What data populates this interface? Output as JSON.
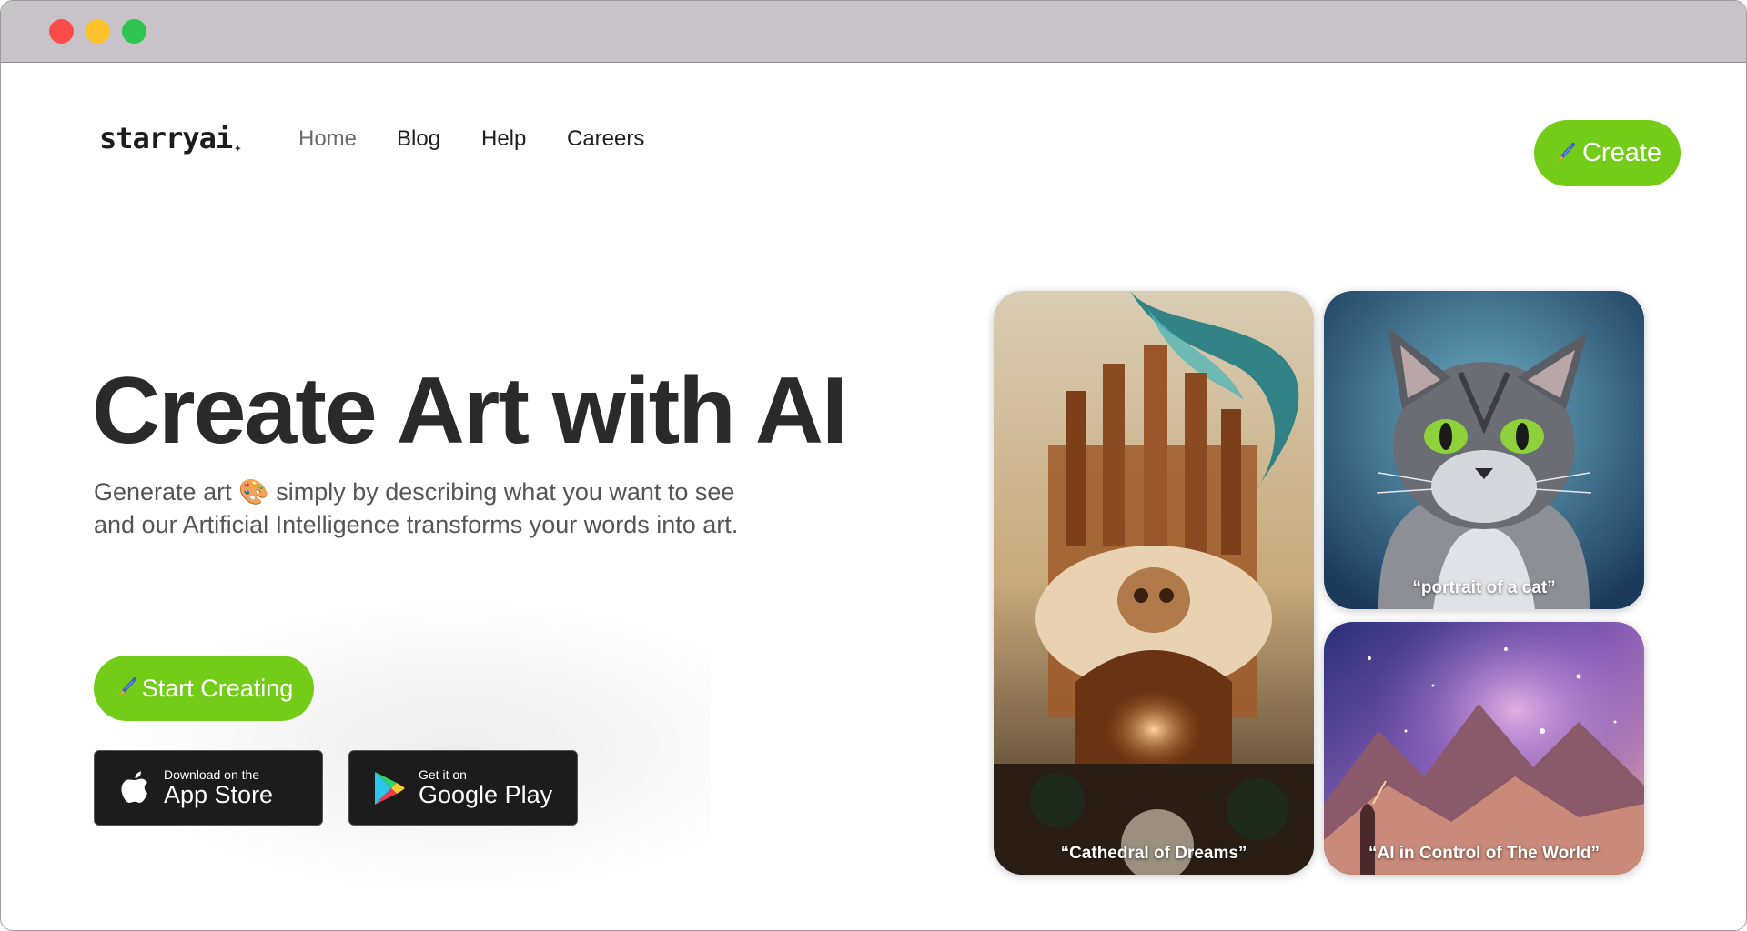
{
  "brand": {
    "logo_text": "starryai",
    "logo_mark": "✦"
  },
  "nav": {
    "items": [
      {
        "label": "Home",
        "active": true
      },
      {
        "label": "Blog",
        "active": false
      },
      {
        "label": "Help",
        "active": false
      },
      {
        "label": "Careers",
        "active": false
      }
    ]
  },
  "header": {
    "create_button": {
      "icon": "paintbrush-icon",
      "label": "Create"
    }
  },
  "hero": {
    "title": "Create Art with AI",
    "subtitle_line1": "Generate art 🎨 simply by describing what you want to see",
    "subtitle_line2": "and our Artificial Intelligence transforms your words into art.",
    "start_button": {
      "icon": "paintbrush-icon",
      "label": "Start Creating"
    }
  },
  "stores": {
    "apple": {
      "small": "Download on the",
      "big": "App Store",
      "icon": "apple-icon"
    },
    "google": {
      "small": "Get it on",
      "big": "Google Play",
      "icon": "google-play-icon"
    }
  },
  "gallery": [
    {
      "caption": "“Cathedral of Dreams”"
    },
    {
      "caption": "“portrait of a cat”"
    },
    {
      "caption": "“AI in Control of The World”"
    }
  ],
  "colors": {
    "accent": "#73cd18",
    "title_text": "#2a2a2a",
    "body_text": "#555555",
    "store_bg": "#1c1c1c"
  }
}
